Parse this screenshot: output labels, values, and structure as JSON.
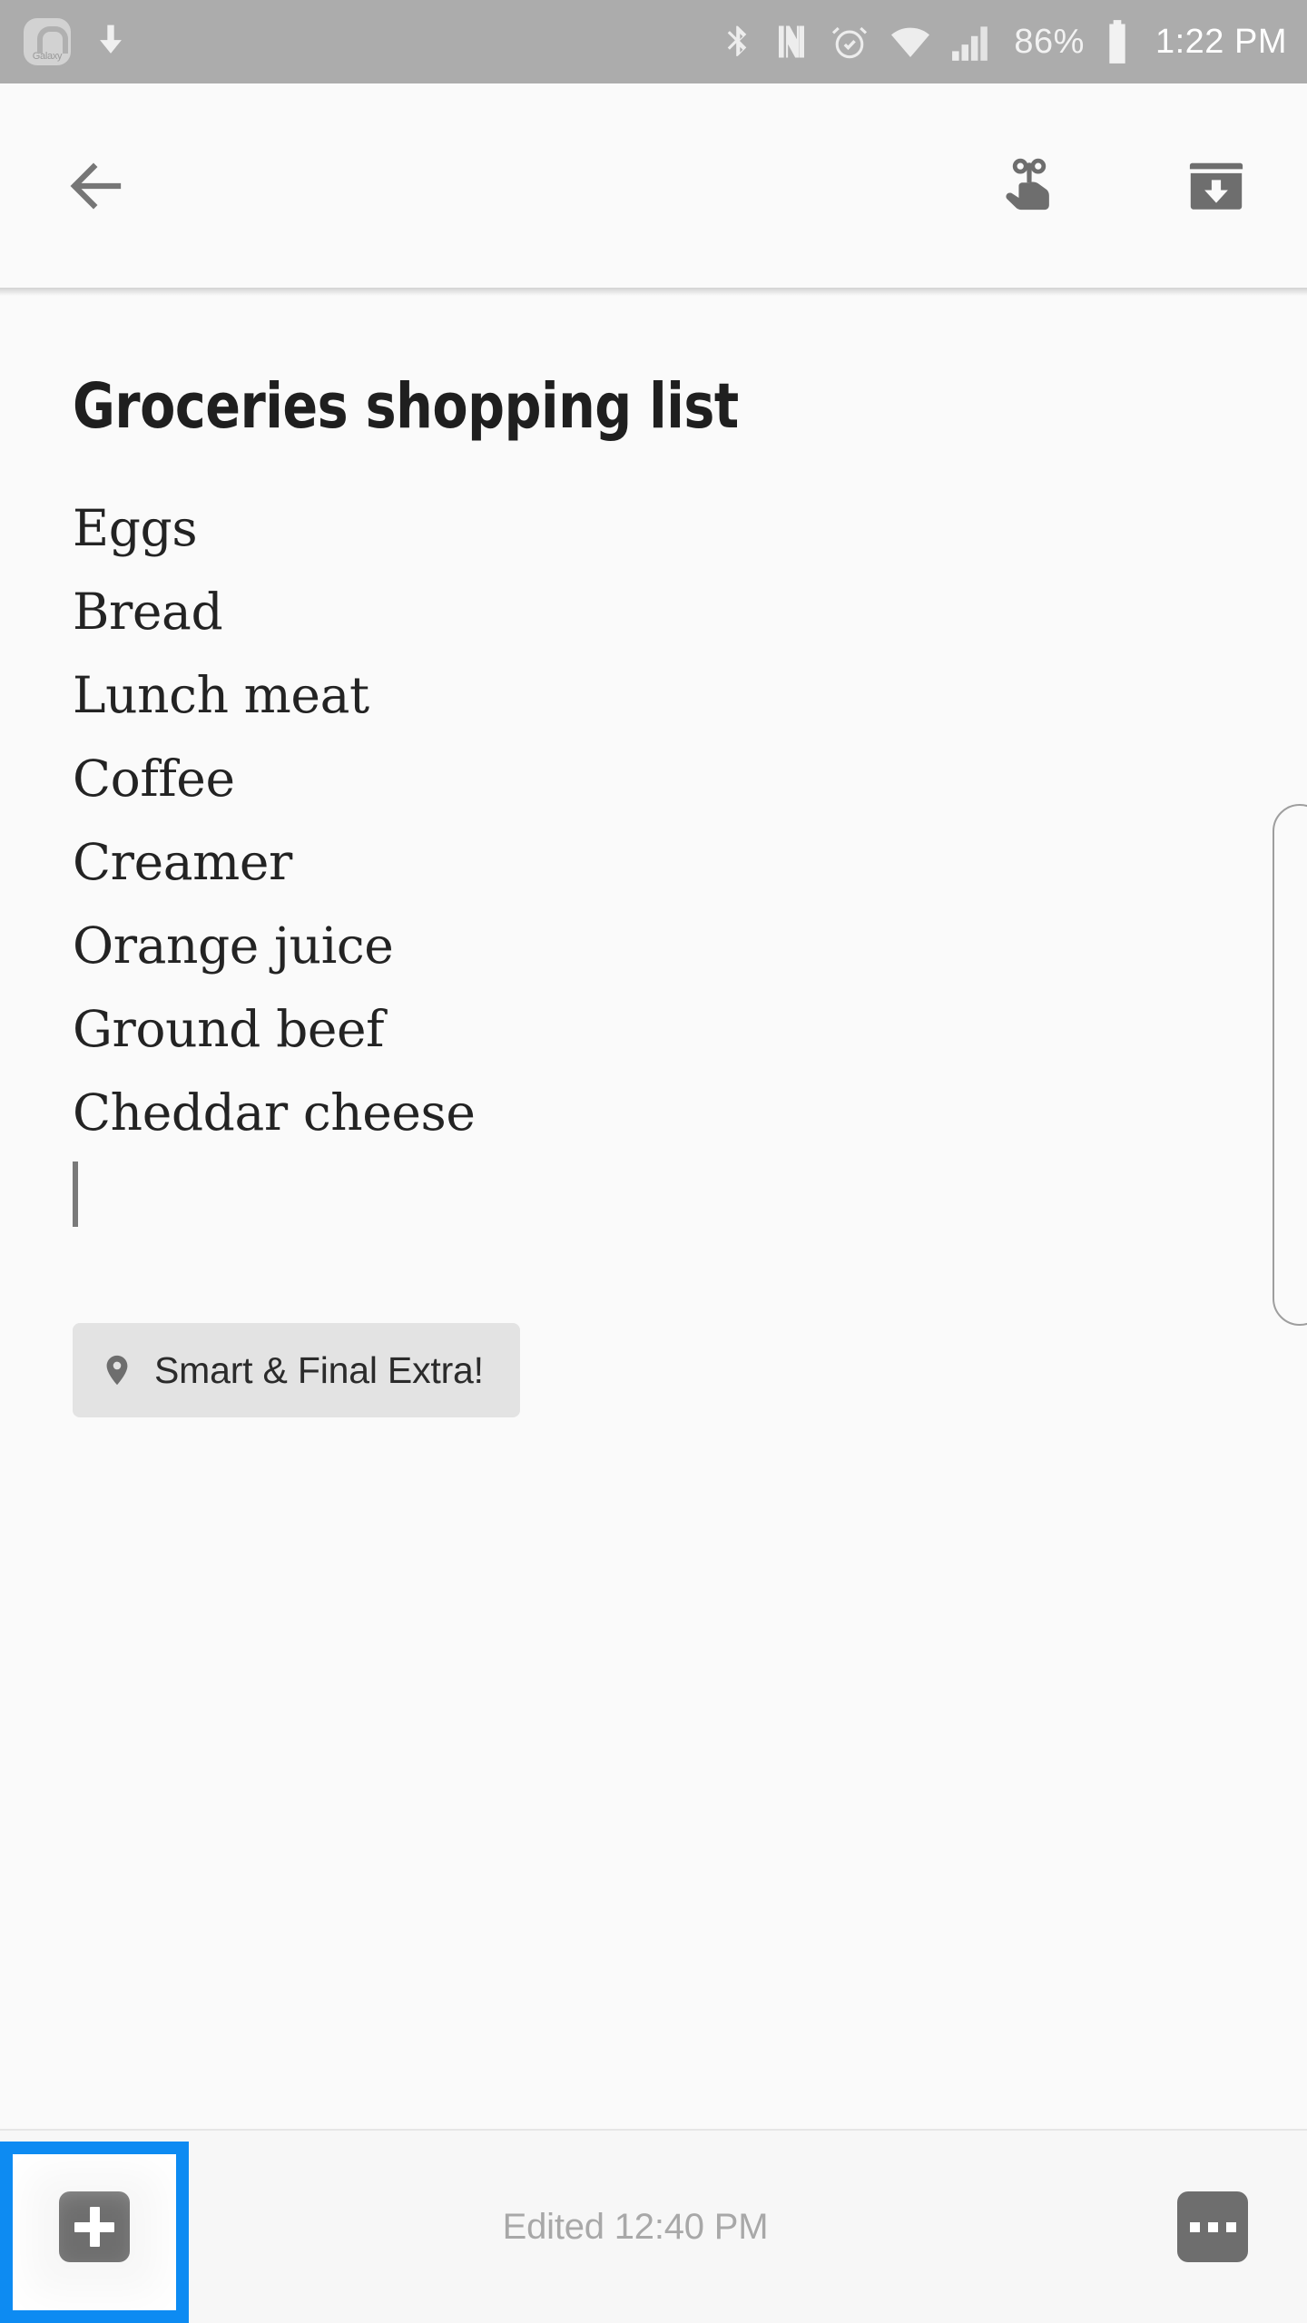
{
  "status_bar": {
    "background_color": "#acacac",
    "left_icons": [
      {
        "name": "galaxy-apps-icon",
        "label": "Galaxy"
      },
      {
        "name": "download-icon",
        "label": ""
      }
    ],
    "right_icons": [
      {
        "name": "bluetooth-icon"
      },
      {
        "name": "nfc-icon"
      },
      {
        "name": "alarm-icon"
      },
      {
        "name": "wifi-icon"
      },
      {
        "name": "cellular-signal-icon"
      }
    ],
    "battery_percent": "86%",
    "battery_icon": "battery-full-icon",
    "time": "1:22 PM"
  },
  "app_bar": {
    "back_label": "back-arrow",
    "actions": [
      {
        "name": "pin-reminder-icon",
        "label": "Reminder"
      },
      {
        "name": "archive-icon",
        "label": "Archive"
      }
    ]
  },
  "note": {
    "title": "Groceries shopping list",
    "lines": [
      "Eggs",
      "Bread",
      "Lunch meat",
      "Coffee",
      "Creamer",
      "Orange juice",
      "Ground beef",
      "Cheddar cheese"
    ],
    "caret_visible": true,
    "location_chip": {
      "icon": "map-pin-icon",
      "label": "Smart & Final Extra!"
    }
  },
  "bottom_bar": {
    "add_button": {
      "name": "add-button",
      "icon": "plus-icon"
    },
    "edited_text": "Edited 12:40 PM",
    "more_button": {
      "name": "more-options-button",
      "icon": "ellipsis-icon"
    }
  },
  "overlay": {
    "focus_highlight_color": "#0d8bf2",
    "focus_target": "add-button"
  }
}
